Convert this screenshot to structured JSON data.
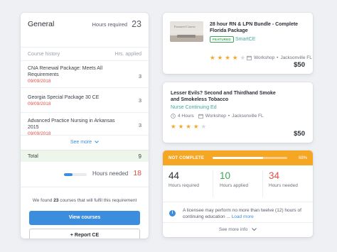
{
  "requirement": {
    "title": "General",
    "hours_required_label": "Hours required",
    "hours_required_value": "23",
    "history_col_label": "Course history",
    "hrs_applied_col_label": "Hrs. applied",
    "history": [
      {
        "name": "CNA Renewal Package: Meets All Requirements",
        "date": "09/09/2018",
        "hours": "3"
      },
      {
        "name": "Georgia Special Package 30 CE",
        "date": "09/09/2018",
        "hours": "3"
      },
      {
        "name": "Advanced Practice Nursing in Arkansas 2015",
        "date": "09/09/2018",
        "hours": "3"
      }
    ],
    "see_more": "See more",
    "total_label": "Total",
    "total_value": "9",
    "hours_needed_label": "Hours needed",
    "hours_needed_value": "18",
    "progress_fraction": 0.39,
    "found_prefix": "We found",
    "found_count": "23",
    "found_suffix": "courses that will fulfil this requirement",
    "view_courses": "View courses",
    "report_ce": "+ Report CE"
  },
  "courses": [
    {
      "title": "28 hour RN & LPN Bundle - Complete Florida Package",
      "has_thumbnail": true,
      "thumbnail_text": "Featured Course",
      "badge": "FEATURED",
      "provider": "SmartCE",
      "rating": 4,
      "hours": "",
      "format": "Workshop",
      "location": "Jacksonville FL",
      "price": "$50"
    },
    {
      "title": "Lesser Evils? Second and Thirdhand Smoke and Smokeless Tobacco",
      "has_thumbnail": false,
      "badge": "",
      "provider": "Nurse Continuing Ed",
      "rating": 4,
      "hours": "4 Hours",
      "format": "Workshop",
      "location": "Jacksonville FL",
      "price": "$50"
    }
  ],
  "progress": {
    "status": "NOT COMPLETE",
    "percent_label": "68%",
    "percent": 68,
    "stats": [
      {
        "value": "44",
        "label": "Hours required",
        "color": "#2b2f36"
      },
      {
        "value": "10",
        "label": "Hours applied",
        "color": "#3aa55a"
      },
      {
        "value": "34",
        "label": "Hours needed",
        "color": "#e14f46"
      }
    ],
    "info_text": "A licensee may perform no more than twelve (12) hours of continuing education ...",
    "load_more": "Load more",
    "see_more_info": "See more info"
  },
  "colors": {
    "accent": "#3c8dde",
    "warning": "#f5a623",
    "success": "#3aa55a",
    "danger": "#e14f46",
    "teal": "#41a8a1"
  }
}
